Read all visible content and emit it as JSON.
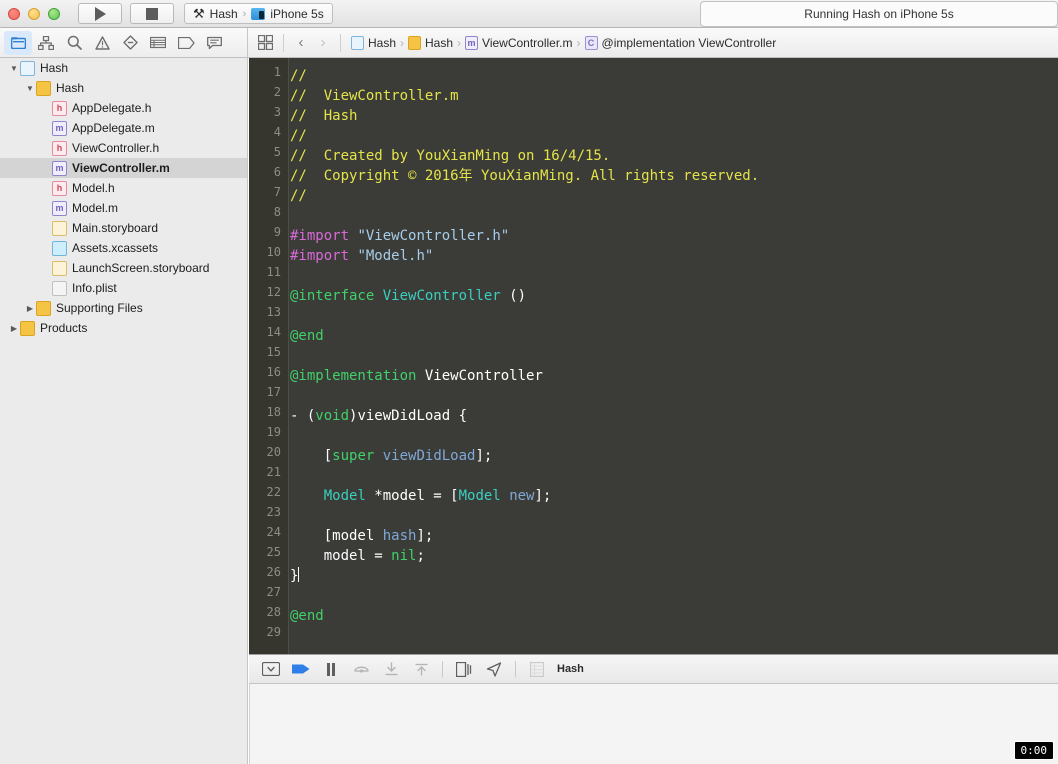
{
  "window": {
    "traffic_lights": [
      "close",
      "minimize",
      "zoom"
    ],
    "status_message": "Running Hash on iPhone 5s"
  },
  "toolbar": {
    "run_label": "Run",
    "stop_label": "Stop",
    "scheme_project": "Hash",
    "scheme_separator": "›",
    "scheme_device": "iPhone 5s"
  },
  "navigator_toolbar": {
    "icons": [
      {
        "name": "project-navigator-icon",
        "glyph": "🗀",
        "selected": true
      },
      {
        "name": "source-control-navigator-icon",
        "glyph": "⛓",
        "selected": false
      },
      {
        "name": "symbol-navigator-icon",
        "glyph": "▤",
        "selected": false
      },
      {
        "name": "find-navigator-icon",
        "glyph": "⌕",
        "selected": false
      },
      {
        "name": "issue-navigator-icon",
        "glyph": "⚠",
        "selected": false
      },
      {
        "name": "test-navigator-icon",
        "glyph": "◇",
        "selected": false
      },
      {
        "name": "debug-navigator-icon",
        "glyph": "☰",
        "selected": false
      },
      {
        "name": "breakpoint-navigator-icon",
        "glyph": "⬟",
        "selected": false
      },
      {
        "name": "report-navigator-icon",
        "glyph": "🗪",
        "selected": false
      }
    ]
  },
  "jumpbar": {
    "back_label": "‹",
    "forward_label": "›",
    "crumbs": [
      {
        "label": "Hash",
        "icon": "project-icon",
        "icon_class": "doc",
        "icon_text": ""
      },
      {
        "label": "Hash",
        "icon": "folder-icon",
        "icon_class": "folder",
        "icon_text": ""
      },
      {
        "label": "ViewController.m",
        "icon": "objc-implementation-file-icon",
        "icon_class": "m",
        "icon_text": "m"
      },
      {
        "label": "@implementation ViewController",
        "icon": "class-symbol-icon",
        "icon_class": "c",
        "icon_text": "C"
      }
    ]
  },
  "sidebar": {
    "items": [
      {
        "label": "Hash",
        "indent": 0,
        "twisty": "▼",
        "icon_class": "proj",
        "icon_text": "",
        "icon_name": "project-icon",
        "active": false
      },
      {
        "label": "Hash",
        "indent": 1,
        "twisty": "▼",
        "icon_class": "fold",
        "icon_text": "",
        "icon_name": "folder-icon",
        "active": false
      },
      {
        "label": "AppDelegate.h",
        "indent": 2,
        "twisty": "",
        "icon_class": "h",
        "icon_text": "h",
        "icon_name": "header-file-icon",
        "active": false
      },
      {
        "label": "AppDelegate.m",
        "indent": 2,
        "twisty": "",
        "icon_class": "m",
        "icon_text": "m",
        "icon_name": "objc-file-icon",
        "active": false
      },
      {
        "label": "ViewController.h",
        "indent": 2,
        "twisty": "",
        "icon_class": "h",
        "icon_text": "h",
        "icon_name": "header-file-icon",
        "active": false
      },
      {
        "label": "ViewController.m",
        "indent": 2,
        "twisty": "",
        "icon_class": "m",
        "icon_text": "m",
        "icon_name": "objc-file-icon",
        "active": true
      },
      {
        "label": "Model.h",
        "indent": 2,
        "twisty": "",
        "icon_class": "h",
        "icon_text": "h",
        "icon_name": "header-file-icon",
        "active": false
      },
      {
        "label": "Model.m",
        "indent": 2,
        "twisty": "",
        "icon_class": "m",
        "icon_text": "m",
        "icon_name": "objc-file-icon",
        "active": false
      },
      {
        "label": "Main.storyboard",
        "indent": 2,
        "twisty": "",
        "icon_class": "sb",
        "icon_text": "",
        "icon_name": "storyboard-icon",
        "active": false
      },
      {
        "label": "Assets.xcassets",
        "indent": 2,
        "twisty": "",
        "icon_class": "xca",
        "icon_text": "",
        "icon_name": "assets-catalog-icon",
        "active": false
      },
      {
        "label": "LaunchScreen.storyboard",
        "indent": 2,
        "twisty": "",
        "icon_class": "sb",
        "icon_text": "",
        "icon_name": "storyboard-icon",
        "active": false
      },
      {
        "label": "Info.plist",
        "indent": 2,
        "twisty": "",
        "icon_class": "plist",
        "icon_text": "",
        "icon_name": "plist-icon",
        "active": false
      },
      {
        "label": "Supporting Files",
        "indent": 1,
        "twisty": "▶",
        "icon_class": "fold",
        "icon_text": "",
        "icon_name": "folder-icon",
        "active": false
      },
      {
        "label": "Products",
        "indent": 0,
        "twisty": "▶",
        "icon_class": "fold",
        "icon_text": "",
        "icon_name": "folder-icon",
        "active": false
      }
    ]
  },
  "editor": {
    "language": "objective-c",
    "total_lines": 29,
    "first_line": 1,
    "colors": {
      "background": "#3b3b37",
      "gutter": "#36362f",
      "comment": "#e4e44a",
      "preprocessor": "#d86ad8",
      "string": "#a7cdea",
      "keyword": "#41d16a",
      "class": "#3ad0c0",
      "method": "#7fa8d8",
      "plain": "#ffffff",
      "line_number": "#8d8d85"
    },
    "lines": [
      {
        "n": 1,
        "tokens": [
          {
            "t": "//",
            "c": "c-com"
          }
        ]
      },
      {
        "n": 2,
        "tokens": [
          {
            "t": "//  ViewController.m",
            "c": "c-com"
          }
        ]
      },
      {
        "n": 3,
        "tokens": [
          {
            "t": "//  Hash",
            "c": "c-com"
          }
        ]
      },
      {
        "n": 4,
        "tokens": [
          {
            "t": "//",
            "c": "c-com"
          }
        ]
      },
      {
        "n": 5,
        "tokens": [
          {
            "t": "//  Created by YouXianMing on 16/4/15.",
            "c": "c-com"
          }
        ]
      },
      {
        "n": 6,
        "tokens": [
          {
            "t": "//  Copyright © 2016年 YouXianMing. All rights reserved.",
            "c": "c-com"
          }
        ]
      },
      {
        "n": 7,
        "tokens": [
          {
            "t": "//",
            "c": "c-com"
          }
        ]
      },
      {
        "n": 8,
        "tokens": []
      },
      {
        "n": 9,
        "tokens": [
          {
            "t": "#import",
            "c": "c-pre"
          },
          {
            "t": " ",
            "c": "c-pln"
          },
          {
            "t": "\"ViewController.h\"",
            "c": "c-str"
          }
        ]
      },
      {
        "n": 10,
        "tokens": [
          {
            "t": "#import",
            "c": "c-pre"
          },
          {
            "t": " ",
            "c": "c-pln"
          },
          {
            "t": "\"Model.h\"",
            "c": "c-str"
          }
        ]
      },
      {
        "n": 11,
        "tokens": []
      },
      {
        "n": 12,
        "tokens": [
          {
            "t": "@interface",
            "c": "c-kw"
          },
          {
            "t": " ",
            "c": "c-pln"
          },
          {
            "t": "ViewController",
            "c": "c-cls"
          },
          {
            "t": " ()",
            "c": "c-pln"
          }
        ]
      },
      {
        "n": 13,
        "tokens": []
      },
      {
        "n": 14,
        "tokens": [
          {
            "t": "@end",
            "c": "c-kw"
          }
        ]
      },
      {
        "n": 15,
        "tokens": []
      },
      {
        "n": 16,
        "tokens": [
          {
            "t": "@implementation",
            "c": "c-kw"
          },
          {
            "t": " ",
            "c": "c-pln"
          },
          {
            "t": "ViewController",
            "c": "c-pln"
          }
        ]
      },
      {
        "n": 17,
        "tokens": []
      },
      {
        "n": 18,
        "tokens": [
          {
            "t": "- (",
            "c": "c-pln"
          },
          {
            "t": "void",
            "c": "c-kw"
          },
          {
            "t": ")viewDidLoad {",
            "c": "c-pln"
          }
        ]
      },
      {
        "n": 19,
        "tokens": []
      },
      {
        "n": 20,
        "tokens": [
          {
            "t": "    [",
            "c": "c-pln"
          },
          {
            "t": "super",
            "c": "c-kw"
          },
          {
            "t": " ",
            "c": "c-pln"
          },
          {
            "t": "viewDidLoad",
            "c": "c-meth"
          },
          {
            "t": "];",
            "c": "c-pln"
          }
        ]
      },
      {
        "n": 21,
        "tokens": []
      },
      {
        "n": 22,
        "tokens": [
          {
            "t": "    ",
            "c": "c-pln"
          },
          {
            "t": "Model",
            "c": "c-cls"
          },
          {
            "t": " *model = [",
            "c": "c-pln"
          },
          {
            "t": "Model",
            "c": "c-cls"
          },
          {
            "t": " ",
            "c": "c-pln"
          },
          {
            "t": "new",
            "c": "c-meth"
          },
          {
            "t": "];",
            "c": "c-pln"
          }
        ]
      },
      {
        "n": 23,
        "tokens": []
      },
      {
        "n": 24,
        "tokens": [
          {
            "t": "    [model ",
            "c": "c-pln"
          },
          {
            "t": "hash",
            "c": "c-meth"
          },
          {
            "t": "];",
            "c": "c-pln"
          }
        ]
      },
      {
        "n": 25,
        "tokens": [
          {
            "t": "    model = ",
            "c": "c-pln"
          },
          {
            "t": "nil",
            "c": "c-kw"
          },
          {
            "t": ";",
            "c": "c-pln"
          }
        ]
      },
      {
        "n": 26,
        "tokens": [
          {
            "t": "}",
            "c": "c-pln"
          }
        ],
        "caret": true
      },
      {
        "n": 27,
        "tokens": []
      },
      {
        "n": 28,
        "tokens": [
          {
            "t": "@end",
            "c": "c-kw"
          }
        ]
      },
      {
        "n": 29,
        "tokens": []
      }
    ]
  },
  "debugbar": {
    "process_label": "Hash",
    "buttons": [
      {
        "name": "hide-debug-area-button",
        "glyph": "▽",
        "style": "boxed"
      },
      {
        "name": "continue-button",
        "glyph": "▶",
        "style": "blue"
      },
      {
        "name": "pause-button",
        "glyph": "‖",
        "style": "pause"
      },
      {
        "name": "step-over-button",
        "glyph": "⤴",
        "style": "dim"
      },
      {
        "name": "step-into-button",
        "glyph": "⤓",
        "style": "dim"
      },
      {
        "name": "step-out-button",
        "glyph": "⤒",
        "style": "dim"
      },
      {
        "name": "view-debugging-button",
        "glyph": "⧉",
        "style": "normal"
      },
      {
        "name": "simulate-location-button",
        "glyph": "➤",
        "style": "normal"
      },
      {
        "name": "stack-frame-button",
        "glyph": "▥",
        "style": "dim"
      }
    ]
  },
  "console": {
    "content": "",
    "timer_badge": "0:00"
  }
}
